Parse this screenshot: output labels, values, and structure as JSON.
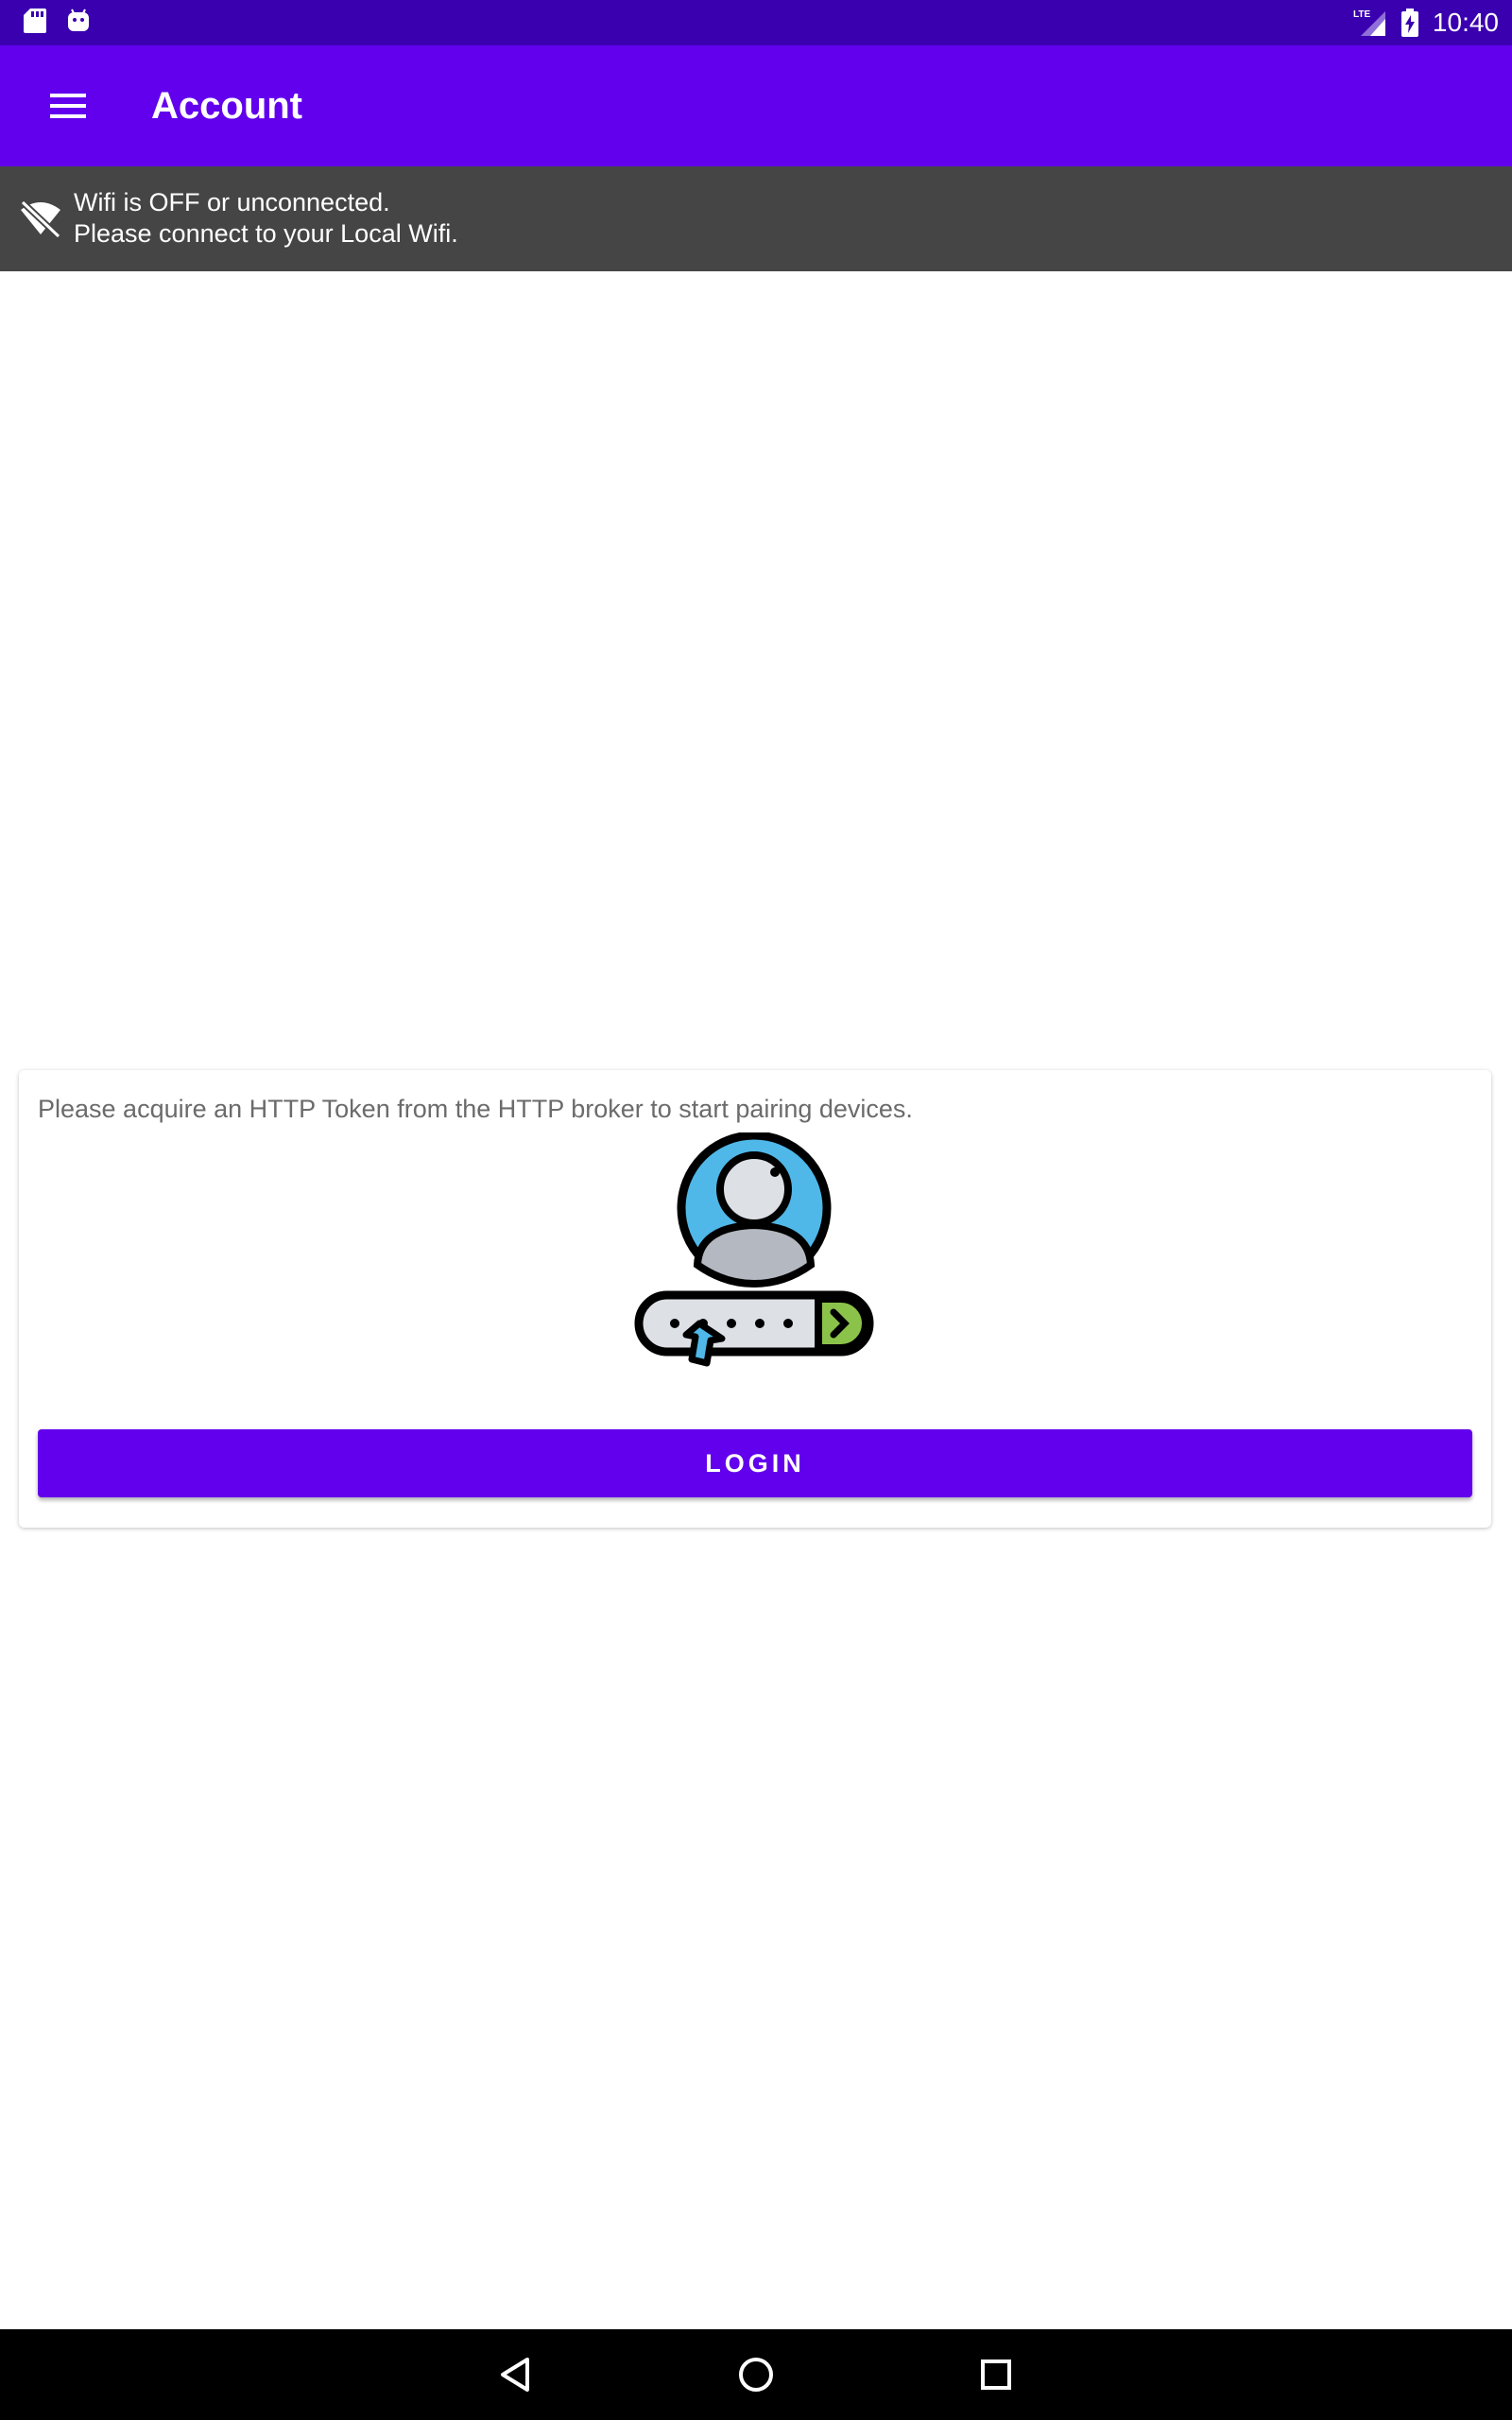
{
  "status_bar": {
    "time": "10:40",
    "left_icons": [
      "sd-card-icon",
      "android-icon"
    ],
    "right_icons": [
      "lte-signal-icon",
      "battery-charging-icon"
    ]
  },
  "app_bar": {
    "title": "Account",
    "menu_icon": "hamburger-menu-icon",
    "background_color": "#6200ee"
  },
  "wifi_banner": {
    "icon": "wifi-off-icon",
    "line1": "Wifi is OFF or unconnected.",
    "line2": "Please connect to your Local Wifi."
  },
  "card": {
    "message": "Please acquire an HTTP Token from the HTTP broker to start pairing devices.",
    "illustration": "user-login-illustration",
    "login_label": "LOGIN"
  },
  "nav_bar": {
    "buttons": [
      "back-icon",
      "home-icon",
      "recents-icon"
    ]
  },
  "colors": {
    "accent": "#6200ee",
    "status_bar": "#3a00b0",
    "banner": "#454545"
  }
}
